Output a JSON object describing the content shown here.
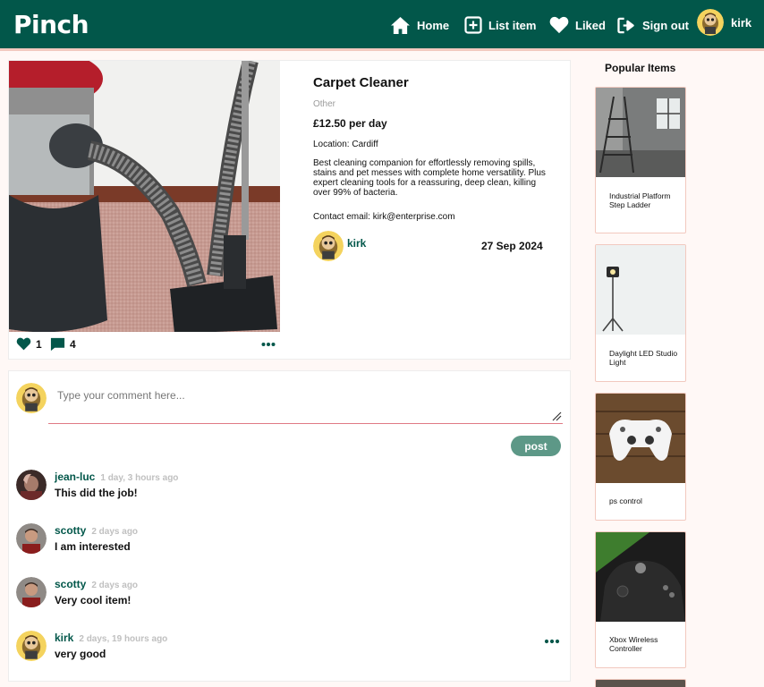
{
  "header": {
    "brand": "Pinch",
    "nav": {
      "home": "Home",
      "list_item": "List item",
      "liked": "Liked",
      "sign_out": "Sign out",
      "username": "kirk"
    }
  },
  "item": {
    "title": "Carpet Cleaner",
    "category": "Other",
    "price": "£12.50 per day",
    "location": "Location: Cardiff",
    "description": "Best cleaning companion for effortlessly removing spills, stains and pet messes with complete home versatility. Plus expert cleaning tools for a reassuring, deep clean, killing over 99% of bacteria.",
    "contact": "Contact email: kirk@enterprise.com",
    "owner": "kirk",
    "date": "27 Sep 2024",
    "likes": "1",
    "comments_count": "4"
  },
  "comment_form": {
    "placeholder": "Type your comment here...",
    "post_label": "post"
  },
  "comments": [
    {
      "author": "jean-luc",
      "time": "1 day, 3 hours ago",
      "text": "This did the job!"
    },
    {
      "author": "scotty",
      "time": "2 days ago",
      "text": "I am interested"
    },
    {
      "author": "scotty",
      "time": "2 days ago",
      "text": "Very cool item!"
    },
    {
      "author": "kirk",
      "time": "2 days, 19 hours ago",
      "text": "very good"
    }
  ],
  "sidebar": {
    "title": "Popular Items",
    "items": [
      {
        "label": "Industrial Platform Step Ladder"
      },
      {
        "label": "Daylight LED Studio Light"
      },
      {
        "label": "ps control"
      },
      {
        "label": "Xbox Wireless Controller"
      }
    ]
  },
  "colors": {
    "header_bg": "#02574a",
    "accent": "#02574a",
    "post_button": "#5d9887",
    "input_underline": "#e07a85",
    "card_border": "#f2c9bf"
  },
  "icons": [
    "home-icon",
    "plus-square-icon",
    "heart-icon",
    "sign-out-icon",
    "comment-icon",
    "ellipsis-icon"
  ]
}
